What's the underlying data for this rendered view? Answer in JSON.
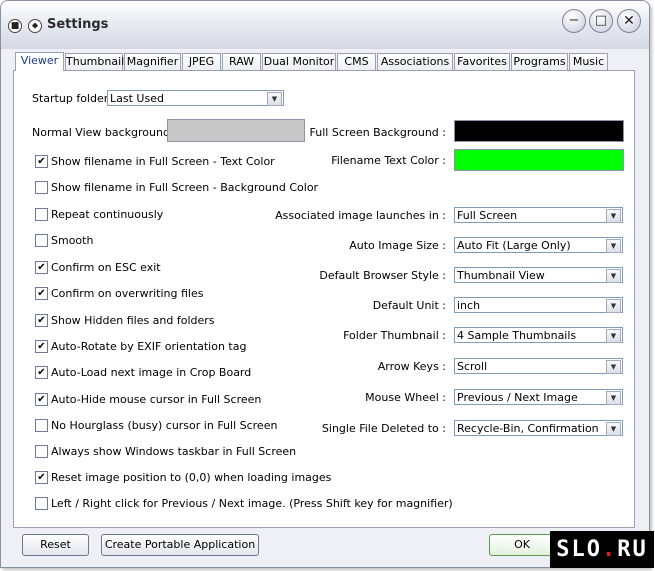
{
  "window": {
    "title": "Settings"
  },
  "tabs": [
    {
      "label": "Viewer"
    },
    {
      "label": "Thumbnail"
    },
    {
      "label": "Magnifier"
    },
    {
      "label": "JPEG"
    },
    {
      "label": "RAW"
    },
    {
      "label": "Dual Monitor"
    },
    {
      "label": "CMS"
    },
    {
      "label": "Associations"
    },
    {
      "label": "Favorites"
    },
    {
      "label": "Programs"
    },
    {
      "label": "Music"
    }
  ],
  "active_tab": "Viewer",
  "startup_folder": {
    "label": "Startup folder:",
    "value": "Last Used"
  },
  "normal_view_bg": {
    "label": "Normal View background :",
    "color": "#c8c8c8"
  },
  "full_screen_bg": {
    "label": "Full Screen Background :",
    "color": "#000000"
  },
  "filename_text_color": {
    "label": "Filename Text Color :",
    "color": "#00ff00"
  },
  "checkboxes": [
    {
      "label": "Show filename in Full Screen - Text Color",
      "checked": true
    },
    {
      "label": "Show filename in Full Screen - Background Color",
      "checked": false
    },
    {
      "label": "Repeat continuously",
      "checked": false
    },
    {
      "label": "Smooth",
      "checked": false
    },
    {
      "label": "Confirm on ESC exit",
      "checked": true
    },
    {
      "label": "Confirm on overwriting files",
      "checked": true
    },
    {
      "label": "Show Hidden files and folders",
      "checked": true
    },
    {
      "label": "Auto-Rotate by EXIF orientation tag",
      "checked": true
    },
    {
      "label": "Auto-Load next image in Crop Board",
      "checked": true
    },
    {
      "label": "Auto-Hide mouse cursor in Full Screen",
      "checked": true
    },
    {
      "label": "No Hourglass (busy) cursor in Full Screen",
      "checked": false
    },
    {
      "label": "Always show Windows taskbar in Full Screen",
      "checked": false
    },
    {
      "label": "Reset image position to (0,0) when loading images",
      "checked": true
    },
    {
      "label": "Left / Right click for Previous / Next image. (Press Shift key for magnifier)",
      "checked": false
    }
  ],
  "dropdowns": [
    {
      "label": "Associated image launches in :",
      "value": "Full Screen"
    },
    {
      "label": "Auto Image Size :",
      "value": "Auto Fit (Large Only)"
    },
    {
      "label": "Default Browser Style :",
      "value": "Thumbnail View"
    },
    {
      "label": "Default Unit :",
      "value": "inch"
    },
    {
      "label": "Folder Thumbnail :",
      "value": "4 Sample Thumbnails"
    },
    {
      "label": "Arrow Keys :",
      "value": "Scroll"
    },
    {
      "label": "Mouse Wheel :",
      "value": "Previous / Next Image"
    },
    {
      "label": "Single File Deleted to :",
      "value": "Recycle-Bin, Confirmation"
    }
  ],
  "buttons": {
    "reset": "Reset",
    "portable": "Create Portable Application",
    "ok": "OK"
  },
  "watermark": {
    "text": "SLO",
    "dot": ".",
    "text2": "RU"
  },
  "icons": {
    "check": "✔",
    "arrow": "▼",
    "minimize": "−",
    "maximize": "□",
    "close": "✕"
  }
}
